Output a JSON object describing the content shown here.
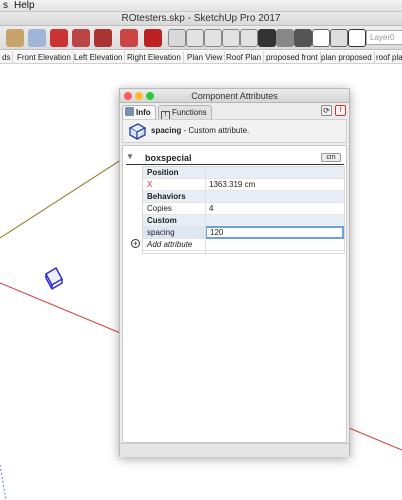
{
  "menu": {
    "items": [
      "s",
      "Help"
    ]
  },
  "window": {
    "title": "ROtesters.skp - SketchUp Pro 2017"
  },
  "toolbar": {
    "layer_value": "Layer0"
  },
  "scenes": [
    "ds",
    "Front Elevation",
    "Left Elevation",
    "Right Elevation",
    "Plan View",
    "Roof Plan",
    "proposed front",
    "plan proposed",
    "roof pla"
  ],
  "dialog": {
    "title": "Component Attributes",
    "tabs": {
      "info": "Info",
      "functions": "Functions"
    },
    "header": {
      "attr_name": "spacing",
      "description": "- Custom attribute."
    },
    "component": {
      "name": "boxspecial",
      "units": "cm"
    },
    "sections": {
      "position": "Position",
      "behaviors": "Behaviors",
      "custom": "Custom"
    },
    "attributes": {
      "x_label": "X",
      "x_value": "1363.319 cm",
      "copies_label": "Copies",
      "copies_value": "4",
      "spacing_label": "spacing",
      "spacing_value": "120"
    },
    "add_attribute": "Add attribute"
  },
  "colors": {
    "axis_red": "#d63a3a",
    "axis_green": "#8a7a1e",
    "selection_blue": "#2b2bd8",
    "input_focus": "#6fa0d8"
  }
}
